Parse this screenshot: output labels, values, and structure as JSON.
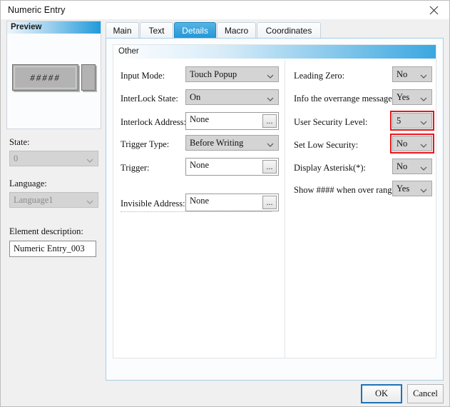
{
  "window": {
    "title": "Numeric Entry",
    "close_icon": "close-icon"
  },
  "sidebar": {
    "preview": {
      "header": "Preview",
      "value": "#####"
    },
    "state": {
      "label": "State:",
      "value": "0",
      "disabled": true
    },
    "language": {
      "label": "Language:",
      "value": "Language1",
      "disabled": true
    },
    "element_description": {
      "label": "Element description:",
      "value": "Numeric Entry_003"
    }
  },
  "tabs": [
    {
      "label": "Main",
      "active": false
    },
    {
      "label": "Text",
      "active": false
    },
    {
      "label": "Details",
      "active": true
    },
    {
      "label": "Macro",
      "active": false
    },
    {
      "label": "Coordinates",
      "active": false
    }
  ],
  "group": {
    "title": "Other"
  },
  "left_fields": [
    {
      "label": "Input Mode:",
      "value": "Touch Popup",
      "kind": "combo"
    },
    {
      "label": "InterLock State:",
      "value": "On",
      "kind": "combo"
    },
    {
      "label": "Interlock Address:",
      "value": "None",
      "kind": "address",
      "browse": "..."
    },
    {
      "label": "Trigger Type:",
      "value": "Before Writing",
      "kind": "combo"
    },
    {
      "label": "Trigger:",
      "value": "None",
      "kind": "address",
      "browse": "..."
    },
    {
      "label": "Invisible Address:",
      "value": "None",
      "kind": "address",
      "browse": "..."
    }
  ],
  "right_fields": [
    {
      "label": "Leading Zero:",
      "value": "No",
      "kind": "combo",
      "highlighted": false
    },
    {
      "label": "Info the overrange message:",
      "value": "Yes",
      "kind": "combo",
      "highlighted": false
    },
    {
      "label": "User Security Level:",
      "value": "5",
      "kind": "combo",
      "highlighted": true
    },
    {
      "label": "Set Low Security:",
      "value": "No",
      "kind": "combo",
      "highlighted": true
    },
    {
      "label": "Display Asterisk(*):",
      "value": "No",
      "kind": "combo",
      "highlighted": false
    },
    {
      "label": "Show #### when over range:",
      "value": "Yes",
      "kind": "combo",
      "highlighted": false
    }
  ],
  "footer": {
    "ok": "OK",
    "cancel": "Cancel"
  },
  "colors": {
    "accent": "#2196d6",
    "highlight": "#e8161a",
    "focus": "#1d72b8"
  }
}
